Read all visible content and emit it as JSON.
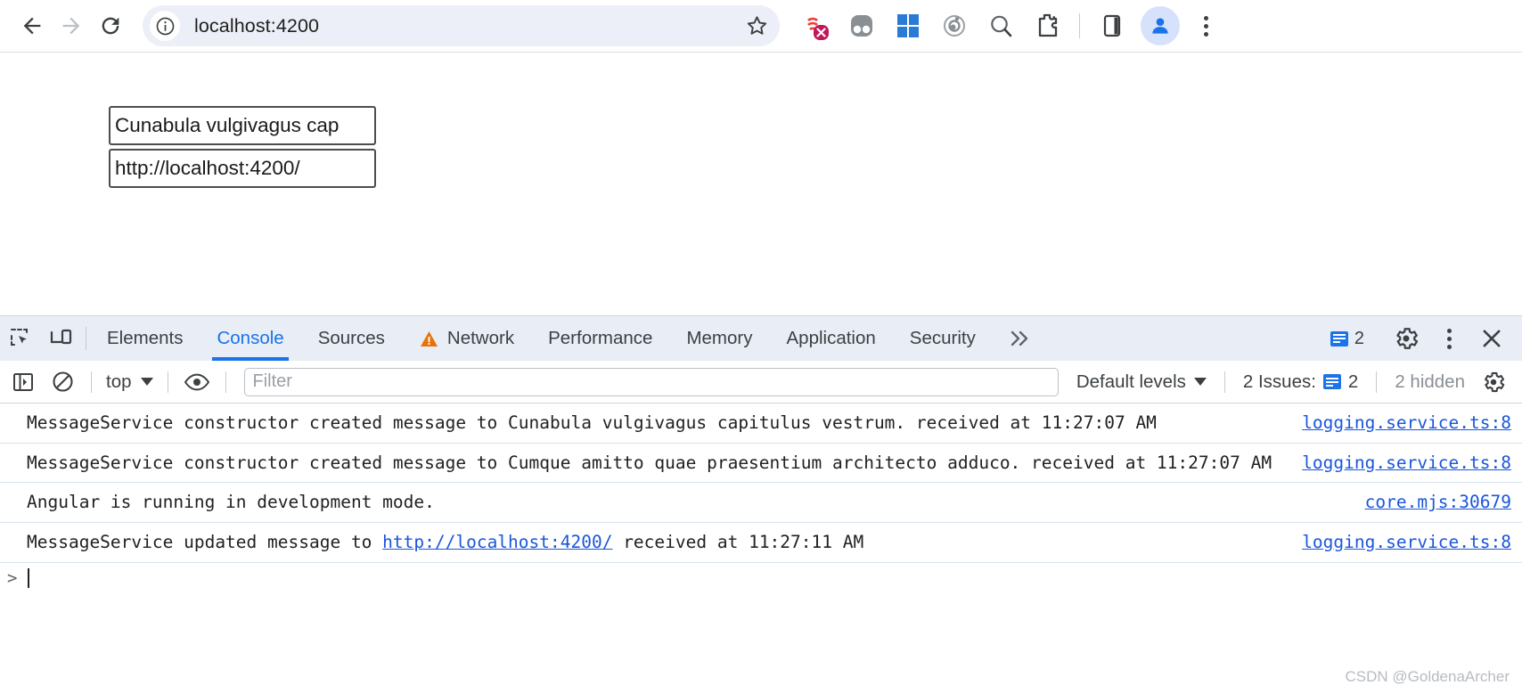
{
  "browser": {
    "back_icon": "arrow-left-icon",
    "forward_icon": "arrow-right-icon",
    "reload_icon": "reload-icon",
    "site_info_icon": "info-circle-icon",
    "url": "localhost:4200",
    "bookmark_icon": "star-outline-icon",
    "extensions": [
      {
        "name": "extension-icon-red-blocked",
        "colors": [
          "#e8443a",
          "#c2185b"
        ]
      },
      {
        "name": "extension-icon-gray-goggles",
        "colors": [
          "#8a8f94"
        ]
      },
      {
        "name": "extension-icon-blue-grid",
        "colors": [
          "#2a7bd6"
        ]
      },
      {
        "name": "extension-icon-target-spiral",
        "colors": [
          "#8e9296"
        ]
      },
      {
        "name": "extension-icon-search-magnifier",
        "colors": [
          "#5f6368"
        ]
      },
      {
        "name": "extension-icon-puzzle-piece",
        "colors": [
          "#3c4043"
        ]
      }
    ],
    "split_view_icon": "side-panel-icon",
    "profile_icon": "account-avatar-icon",
    "menu_icon": "kebab-menu-icon"
  },
  "page": {
    "message_input": "Cunabula vulgivagus cap",
    "url_input": "http://localhost:4200/"
  },
  "devtools": {
    "inspect_icon": "inspect-element-icon",
    "device_toolbar_icon": "device-toggle-icon",
    "tabs": [
      {
        "label": "Elements",
        "active": false,
        "warning": false
      },
      {
        "label": "Console",
        "active": true,
        "warning": false
      },
      {
        "label": "Sources",
        "active": false,
        "warning": false
      },
      {
        "label": "Network",
        "active": false,
        "warning": true
      },
      {
        "label": "Performance",
        "active": false,
        "warning": false
      },
      {
        "label": "Memory",
        "active": false,
        "warning": false
      },
      {
        "label": "Application",
        "active": false,
        "warning": false
      },
      {
        "label": "Security",
        "active": false,
        "warning": false
      }
    ],
    "overflow_label": "»",
    "issues_count": "2",
    "settings_icon": "gear-icon",
    "more_icon": "kebab-menu-icon",
    "close_icon": "close-x-icon",
    "accent_color": "#1a73e8",
    "warning_color": "#e8710a"
  },
  "console_toolbar": {
    "sidebar_icon": "console-sidebar-toggle-icon",
    "clear_icon": "clear-console-icon",
    "context": "top",
    "eye_icon": "live-expression-eye-icon",
    "filter_placeholder": "Filter",
    "filter_value": "",
    "levels": "Default levels",
    "issues_label": "2 Issues:",
    "issues_count": "2",
    "hidden_label": "2 hidden",
    "settings_icon": "gear-icon"
  },
  "console_messages": [
    {
      "text": "MessageService constructor created message to Cunabula vulgivagus capitulus vestrum. received at 11:27:07 AM",
      "source": "logging.service.ts:8",
      "link": null
    },
    {
      "text": "MessageService constructor created message to Cumque amitto quae praesentium architecto adduco. received at 11:27:07 AM",
      "source": "logging.service.ts:8",
      "link": null
    },
    {
      "text": "Angular is running in development mode.",
      "source": "core.mjs:30679",
      "link": null
    },
    {
      "text_before": "MessageService updated message to ",
      "link": "http://localhost:4200/",
      "text_after": " received at 11:27:11 AM",
      "source": "logging.service.ts:8"
    }
  ],
  "prompt": {
    "caret": ">",
    "value": ""
  },
  "watermark": "CSDN @GoldenaArcher"
}
